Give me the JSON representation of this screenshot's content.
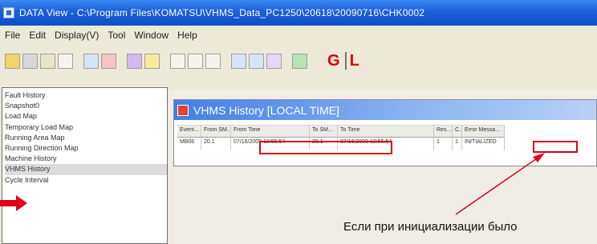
{
  "window": {
    "title": "DATA View - C:\\Program Files\\KOMATSU\\VHMS_Data_PC1250\\20618\\20090716\\CHK0002"
  },
  "menubar": {
    "items": [
      "File",
      "Edit",
      "Display(V)",
      "Tool",
      "Window",
      "Help"
    ]
  },
  "toolbar": {
    "icons": [
      "open-icon",
      "print-icon",
      "preview-icon",
      "copy-icon",
      "undo-icon",
      "chart-icon",
      "graph-icon",
      "filter-icon",
      "grid-icon",
      "table-icon",
      "window-icon",
      "tile-icon",
      "check-icon",
      "exit-icon"
    ],
    "gl_left": "G",
    "gl_right": "L"
  },
  "nav": {
    "items": [
      "Fault History",
      "Snapshot0",
      "Load Map",
      "Temporary Load Map",
      "Running Area Map",
      "Running Direction Map",
      "Machine History",
      "VHMS History",
      "Cycle Interval"
    ],
    "active_index": 7
  },
  "subwindow": {
    "title": "VHMS History  [LOCAL TIME]",
    "columns": [
      "Event...",
      "From SM...",
      "From Time",
      "To SM...",
      "To Time",
      "Res...",
      "C...",
      "Error Messa..."
    ],
    "rows": [
      [
        "MB06",
        "20.1",
        "07/16/2009 12:55:54",
        "20.1",
        "07/16/2009 12:55:54",
        "1",
        "1",
        "INITIALIZED"
      ]
    ]
  },
  "annotation": {
    "caption": "Если при инициализации было",
    "color": "#e1001a"
  }
}
